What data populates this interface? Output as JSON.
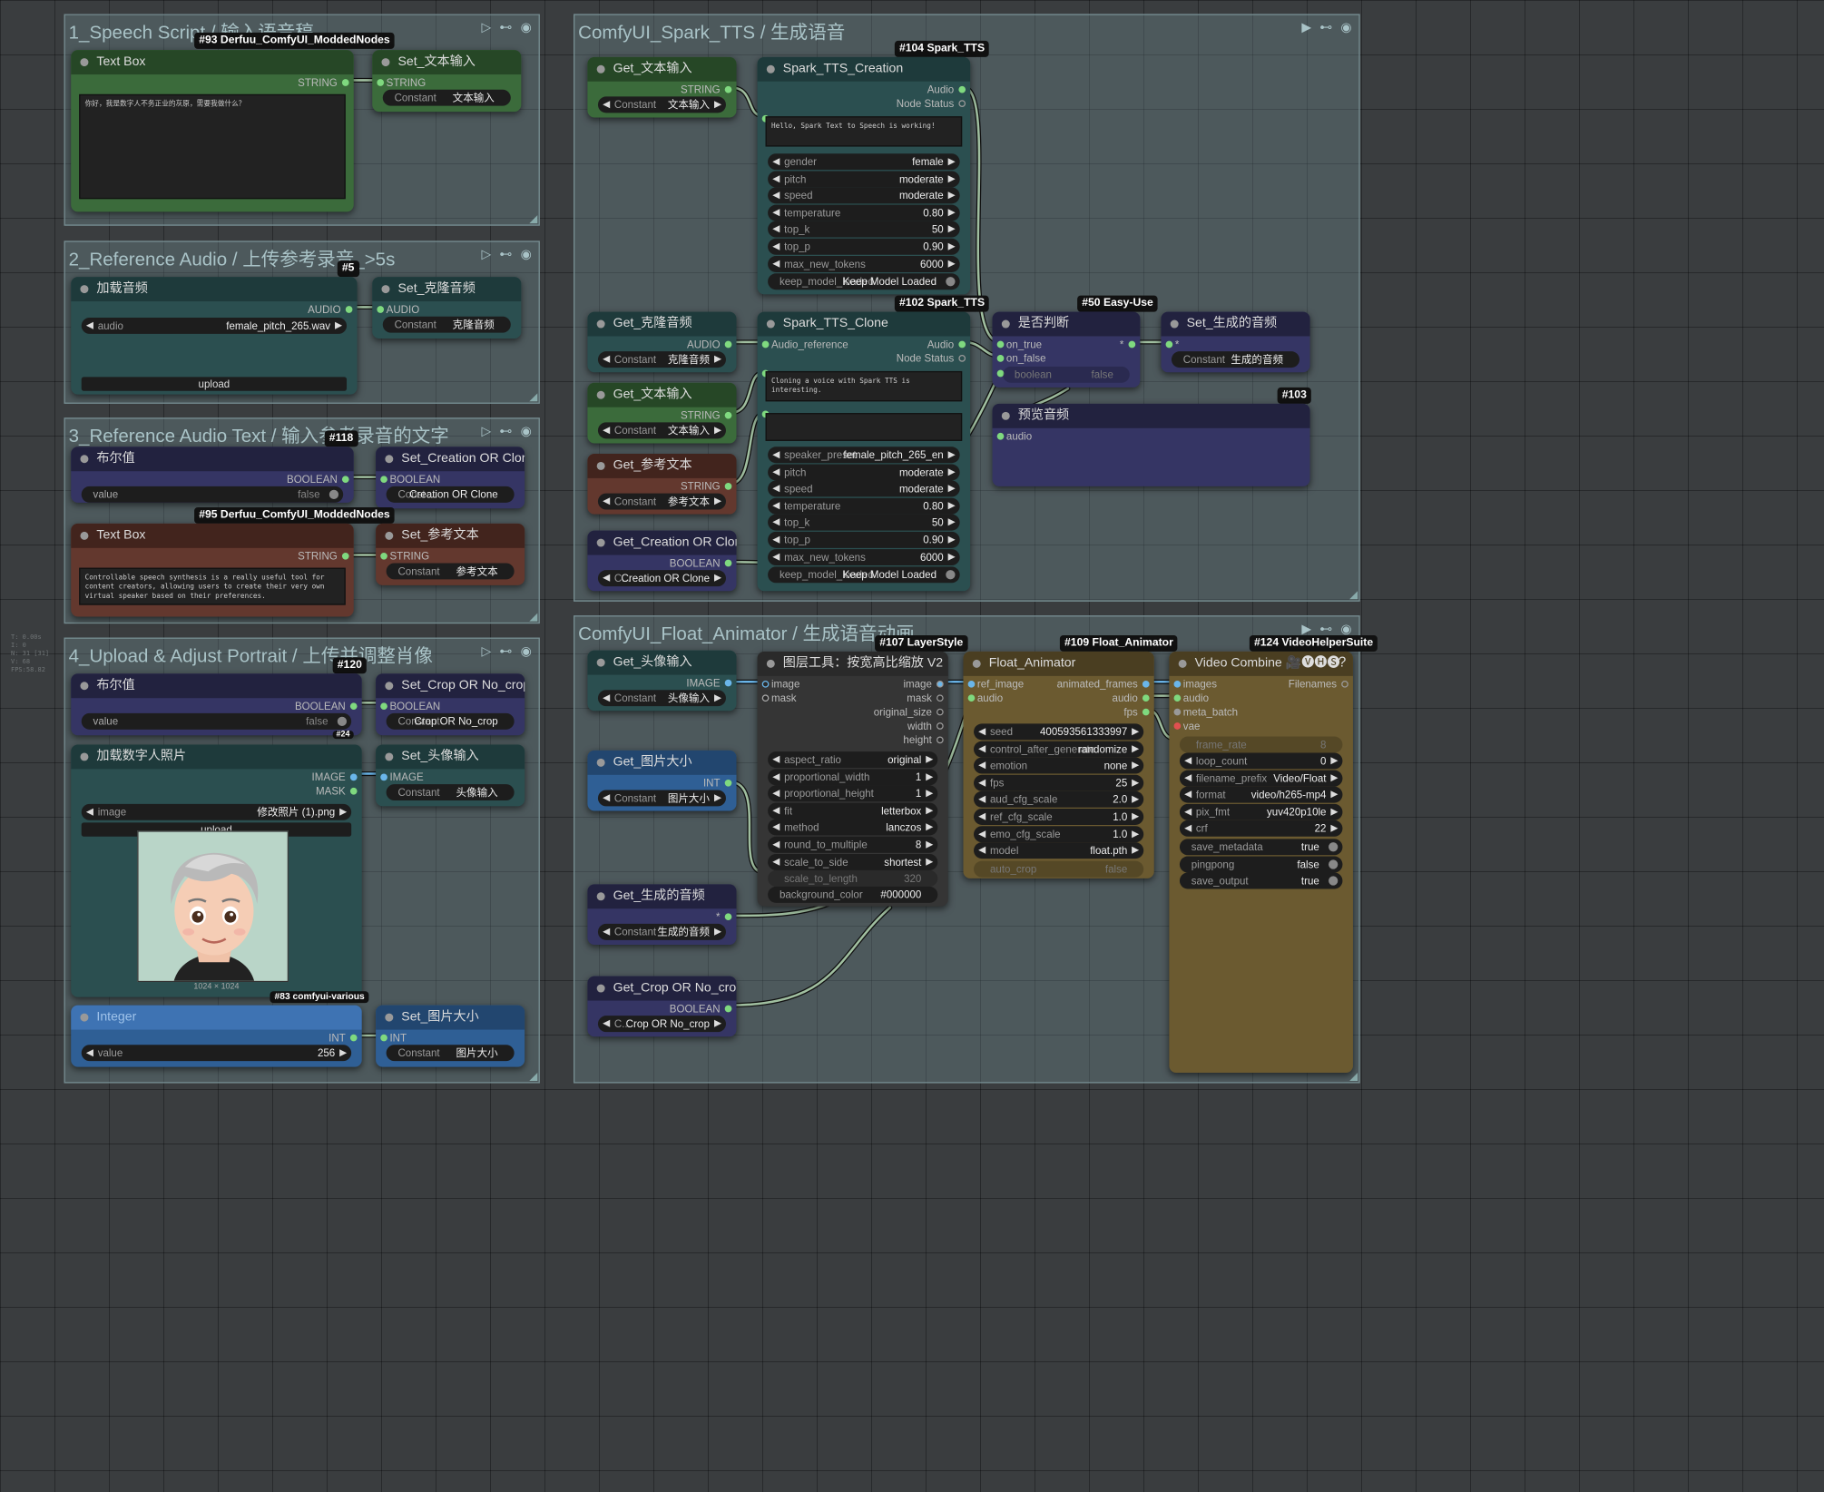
{
  "groups": [
    {
      "title": "1_Speech Script / 输入语音稿",
      "icons": "▷ ⊷ ◉"
    },
    {
      "title": "2_Reference Audio / 上传参考录音_>5s",
      "icons": "▷ ⊷ ◉"
    },
    {
      "title": "3_Reference Audio Text / 输入参考录音的文字",
      "icons": "▷ ⊷ ◉"
    },
    {
      "title": "4_Upload & Adjust Portrait / 上传并调整肖像",
      "icons": "▷ ⊷ ◉"
    },
    {
      "title": "ComfyUI_Spark_TTS / 生成语音",
      "icons": "▶ ⊷ ◉"
    },
    {
      "title": "ComfyUI_Float_Animator / 生成语音动画",
      "icons": "▶ ⊷ ◉"
    }
  ],
  "badges": [
    "#93 Derfuu_ComfyUI_ModdedNodes",
    "#5",
    "#118",
    "#95 Derfuu_ComfyUI_ModdedNodes",
    "#120",
    "#24",
    "#83 comfyui-various",
    "#104 Spark_TTS",
    "#102 Spark_TTS",
    "#50 Easy-Use",
    "#103",
    "#107 LayerStyle",
    "#109 Float_Animator",
    "#124 VideoHelperSuite"
  ],
  "n93": {
    "title": "Text Box",
    "out": "STRING",
    "text": "你好，我是数字人不务正业的灰原，需要我做什么？"
  },
  "setText": {
    "title": "Set_文本输入",
    "in": "STRING",
    "w": "Constant",
    "v": "文本输入"
  },
  "n5": {
    "title": "加载音频",
    "out": "AUDIO",
    "w": "audio",
    "v": "female_pitch_265.wav",
    "btn": "upload"
  },
  "setClone": {
    "title": "Set_克隆音频",
    "in": "AUDIO",
    "w": "Constant",
    "v": "克隆音频"
  },
  "n118": {
    "title": "布尔值",
    "out": "BOOLEAN",
    "w": "value",
    "v": "false"
  },
  "setCoc": {
    "title": "Set_Creation OR Clone",
    "in": "BOOLEAN",
    "w": "Const ...",
    "v": "Creation OR Clone"
  },
  "n95": {
    "title": "Text Box",
    "out": "STRING",
    "text": "Controllable speech synthesis is a really useful tool for content creators, allowing users to create their very own virtual speaker based on their preferences."
  },
  "setRef": {
    "title": "Set_参考文本",
    "in": "STRING",
    "w": "Constant",
    "v": "参考文本"
  },
  "n120": {
    "title": "布尔值",
    "out": "BOOLEAN",
    "w": "value",
    "v": "false"
  },
  "setCrop": {
    "title": "Set_Crop OR No_crop",
    "in": "BOOLEAN",
    "w": "Constant",
    "v": "Crop OR No_crop"
  },
  "n24": {
    "title": "加载数字人照片",
    "out1": "IMAGE",
    "out2": "MASK",
    "w": "image",
    "v": "修改照片 (1).png",
    "btn": "upload",
    "cap": "1024 × 1024"
  },
  "setHead": {
    "title": "Set_头像输入",
    "in": "IMAGE",
    "w": "Constant",
    "v": "头像输入"
  },
  "n83": {
    "title": "Integer",
    "out": "INT",
    "w": "value",
    "v": "256"
  },
  "setSize": {
    "title": "Set_图片大小",
    "in": "INT",
    "w": "Constant",
    "v": "图片大小"
  },
  "getText1": {
    "title": "Get_文本输入",
    "out": "STRING",
    "w": "Constant",
    "v": "文本输入"
  },
  "getClone": {
    "title": "Get_克隆音频",
    "out": "AUDIO",
    "w": "Constant",
    "v": "克隆音频"
  },
  "getText2": {
    "title": "Get_文本输入",
    "out": "STRING",
    "w": "Constant",
    "v": "文本输入"
  },
  "getRef": {
    "title": "Get_参考文本",
    "out": "STRING",
    "w": "Constant",
    "v": "参考文本"
  },
  "getCoc": {
    "title": "Get_Creation OR Clone",
    "out": "BOOLEAN",
    "w": "C...",
    "v": "Creation OR Clone"
  },
  "n104": {
    "title": "Spark_TTS_Creation",
    "out1": "Audio",
    "out2": "Node Status",
    "text": "Hello, Spark Text to Speech is working!",
    "widgets": [
      [
        "gender",
        "female"
      ],
      [
        "pitch",
        "moderate"
      ],
      [
        "speed",
        "moderate"
      ],
      [
        "temperature",
        "0.80"
      ],
      [
        "top_k",
        "50"
      ],
      [
        "top_p",
        "0.90"
      ],
      [
        "max_new_tokens",
        "6000"
      ]
    ],
    "keep": [
      "keep_model_loaded",
      "Keep Model Loaded"
    ]
  },
  "n102": {
    "title": "Spark_TTS_Clone",
    "in": "Audio_reference",
    "out1": "Audio",
    "out2": "Node Status",
    "text": "Cloning a voice with Spark TTS is interesting.",
    "widgets": [
      [
        "speaker_preset",
        "female_pitch_265_en"
      ],
      [
        "pitch",
        "moderate"
      ],
      [
        "speed",
        "moderate"
      ],
      [
        "temperature",
        "0.80"
      ],
      [
        "top_k",
        "50"
      ],
      [
        "top_p",
        "0.90"
      ],
      [
        "max_new_tokens",
        "6000"
      ]
    ],
    "keep": [
      "keep_model_loaded",
      "Keep Model Loaded"
    ]
  },
  "n50": {
    "title": "是否判断",
    "in1": "on_true",
    "in2": "on_false",
    "w": "boolean",
    "v": "false",
    "out": "*"
  },
  "setGen": {
    "title": "Set_生成的音频",
    "in": "*",
    "w": "Constant",
    "v": "生成的音频"
  },
  "n103": {
    "title": "预览音频",
    "in": "audio"
  },
  "getHead": {
    "title": "Get_头像输入",
    "out": "IMAGE",
    "w": "Constant",
    "v": "头像输入"
  },
  "getSize": {
    "title": "Get_图片大小",
    "out": "INT",
    "w": "Constant",
    "v": "图片大小"
  },
  "getGen": {
    "title": "Get_生成的音频",
    "out": "*",
    "w": "Constant",
    "v": "生成的音频"
  },
  "getCrop": {
    "title": "Get_Crop OR No_crop",
    "out": "BOOLEAN",
    "w": "C...",
    "v": "Crop OR No_crop"
  },
  "n107": {
    "title": "图层工具：按宽高比缩放 V2",
    "in1": "image",
    "in2": "mask",
    "outs": [
      "image",
      "mask",
      "original_size",
      "width",
      "height"
    ],
    "widgets": [
      [
        "aspect_ratio",
        "original"
      ],
      [
        "proportional_width",
        "1"
      ],
      [
        "proportional_height",
        "1"
      ],
      [
        "fit",
        "letterbox"
      ],
      [
        "method",
        "lanczos"
      ],
      [
        "round_to_multiple",
        "8"
      ],
      [
        "scale_to_side",
        "shortest"
      ]
    ],
    "dis": [
      "scale_to_length",
      "320"
    ],
    "bg": [
      "background_color",
      "#000000"
    ]
  },
  "n109": {
    "title": "Float_Animator",
    "in1": "ref_image",
    "in2": "audio",
    "outs": [
      "animated_frames",
      "audio",
      "fps"
    ],
    "widgets": [
      [
        "seed",
        "400593561333997"
      ],
      [
        "control_after_generate",
        "randomize"
      ],
      [
        "emotion",
        "none"
      ],
      [
        "fps",
        "25"
      ],
      [
        "aud_cfg_scale",
        "2.0"
      ],
      [
        "ref_cfg_scale",
        "1.0"
      ],
      [
        "emo_cfg_scale",
        "1.0"
      ],
      [
        "model",
        "float.pth"
      ]
    ],
    "dis": [
      "auto_crop",
      "false"
    ]
  },
  "n124": {
    "title": "Video Combine 🎥🅥🅗🅢",
    "help": "?",
    "ins": [
      "images",
      "audio",
      "meta_batch",
      "vae"
    ],
    "out": "Filenames",
    "widgets": [
      [
        "loop_count",
        "0"
      ],
      [
        "filename_prefix",
        "Video/Float"
      ],
      [
        "format",
        "video/h265-mp4"
      ],
      [
        "pix_fmt",
        "yuv420p10le"
      ],
      [
        "crf",
        "22"
      ]
    ],
    "dis": [
      "frame_rate",
      "8"
    ],
    "toggles": [
      [
        "save_metadata",
        "true"
      ],
      [
        "pingpong",
        "false"
      ],
      [
        "save_output",
        "true"
      ]
    ]
  },
  "info": [
    "T: 0.00s",
    "I: 0",
    "N: 31 [31]",
    "V: 68",
    "FPS:58.82"
  ]
}
